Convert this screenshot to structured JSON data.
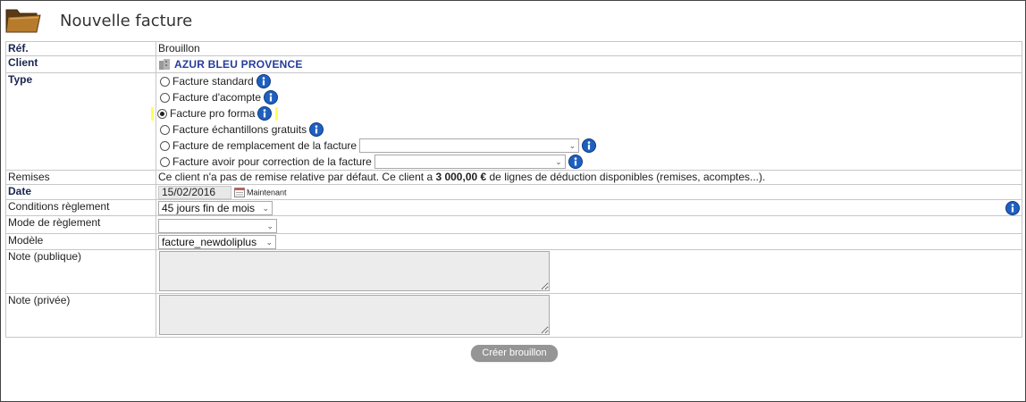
{
  "header": {
    "title": "Nouvelle facture",
    "icon": "folder-icon"
  },
  "form": {
    "ref": {
      "label": "Réf.",
      "value": "Brouillon"
    },
    "client": {
      "label": "Client",
      "value": "AZUR BLEU PROVENCE",
      "icon": "company-icon"
    },
    "type": {
      "label": "Type",
      "options": [
        {
          "label": "Facture standard",
          "selected": false
        },
        {
          "label": "Facture d'acompte",
          "selected": false
        },
        {
          "label": "Facture pro forma",
          "selected": true
        },
        {
          "label": "Facture échantillons gratuits",
          "selected": false
        },
        {
          "label": "Facture de remplacement de la facture",
          "selected": false,
          "select_value": ""
        },
        {
          "label": "Facture avoir pour correction de la facture",
          "selected": false,
          "select_value": ""
        }
      ]
    },
    "remises": {
      "label": "Remises",
      "text_before": "Ce client n'a pas de remise relative par défaut. Ce client a ",
      "amount": "3 000,00 €",
      "text_after": " de lignes de déduction disponibles (remises, acomptes...)."
    },
    "date": {
      "label": "Date",
      "value": "15/02/2016",
      "now_label": "Maintenant"
    },
    "conditions": {
      "label": "Conditions règlement",
      "value": "45 jours fin de mois"
    },
    "mode": {
      "label": "Mode de règlement",
      "value": ""
    },
    "modele": {
      "label": "Modèle",
      "value": "facture_newdoliplus"
    },
    "note_public": {
      "label": "Note (publique)",
      "value": ""
    },
    "note_private": {
      "label": "Note (privée)",
      "value": ""
    }
  },
  "actions": {
    "create_label": "Créer brouillon"
  },
  "colors": {
    "link": "#263c9c",
    "highlight": "#ffff5a",
    "button": "#959595",
    "info_icon": "#1f5fbf"
  }
}
